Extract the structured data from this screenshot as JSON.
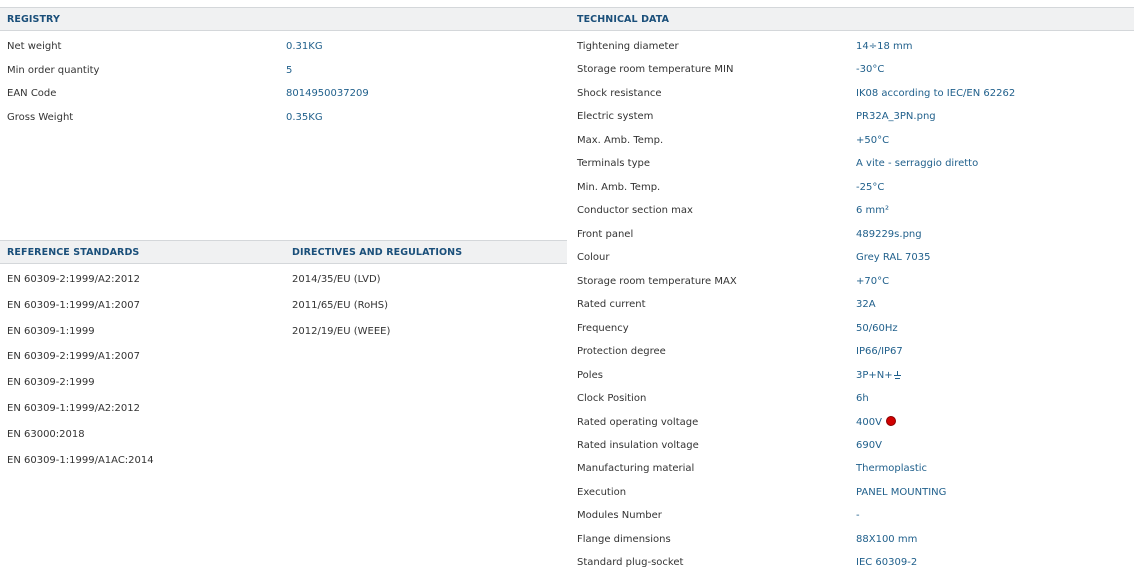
{
  "registry": {
    "title": "REGISTRY",
    "rows": [
      {
        "label": "Net weight",
        "value": "0.31KG"
      },
      {
        "label": "Min order quantity",
        "value": "5"
      },
      {
        "label": "EAN Code",
        "value": "8014950037209"
      },
      {
        "label": "Gross Weight",
        "value": "0.35KG"
      }
    ]
  },
  "reference_standards": {
    "title": "REFERENCE STANDARDS",
    "items": [
      "EN 60309-2:1999/A2:2012",
      "EN 60309-1:1999/A1:2007",
      "EN 60309-1:1999",
      "EN 60309-2:1999/A1:2007",
      "EN 60309-2:1999",
      "EN 60309-1:1999/A2:2012",
      "EN 63000:2018",
      "EN 60309-1:1999/A1AC:2014"
    ]
  },
  "directives": {
    "title": "DIRECTIVES AND REGULATIONS",
    "items": [
      "2014/35/EU (LVD)",
      "2011/65/EU (RoHS)",
      "2012/19/EU (WEEE)"
    ]
  },
  "technical": {
    "title": "TECHNICAL DATA",
    "rows": [
      {
        "label": "Tightening diameter",
        "value": "14÷18 mm"
      },
      {
        "label": "Storage room temperature MIN",
        "value": "-30°C"
      },
      {
        "label": "Shock resistance",
        "value": "IK08 according to IEC/EN 62262"
      },
      {
        "label": "Electric system",
        "value": "PR32A_3PN.png"
      },
      {
        "label": "Max. Amb. Temp.",
        "value": "+50°C"
      },
      {
        "label": "Terminals type",
        "value": "A vite - serraggio diretto"
      },
      {
        "label": "Min. Amb. Temp.",
        "value": "-25°C"
      },
      {
        "label": "Conductor section max",
        "value": "6 mm²"
      },
      {
        "label": "Front panel",
        "value": "489229s.png"
      },
      {
        "label": "Colour",
        "value": "Grey RAL 7035"
      },
      {
        "label": "Storage room temperature MAX",
        "value": "+70°C"
      },
      {
        "label": "Rated current",
        "value": "32A"
      },
      {
        "label": "Frequency",
        "value": "50/60Hz"
      },
      {
        "label": "Protection degree",
        "value": "IP66/IP67"
      },
      {
        "label": "Poles",
        "value": "3P+N+",
        "icon": "earth-ground-icon"
      },
      {
        "label": "Clock Position",
        "value": "6h"
      },
      {
        "label": "Rated operating voltage",
        "value": "400V",
        "icon": "red-dot-icon",
        "icon_color": "#d10000"
      },
      {
        "label": "Rated insulation voltage",
        "value": "690V"
      },
      {
        "label": "Manufacturing material",
        "value": "Thermoplastic"
      },
      {
        "label": "Execution",
        "value": "PANEL MOUNTING"
      },
      {
        "label": "Modules Number",
        "value": "-"
      },
      {
        "label": "Flange dimensions",
        "value": "88X100 mm"
      },
      {
        "label": "Standard plug-socket",
        "value": "IEC 60309-2"
      }
    ]
  },
  "colors": {
    "header_bg": "#f0f1f2",
    "title": "#1a4f7a",
    "value": "#1f5f8b",
    "label": "#333333"
  }
}
